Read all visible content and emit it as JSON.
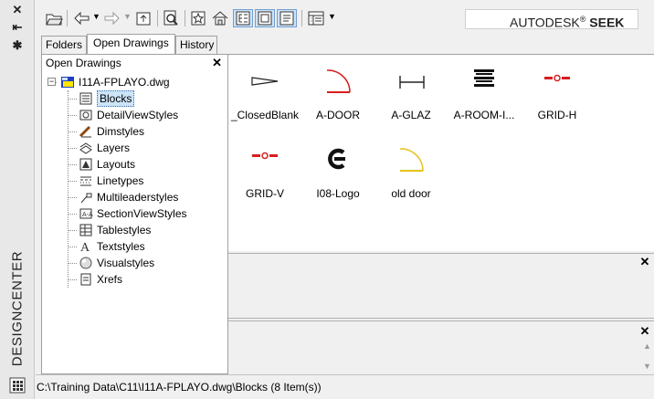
{
  "palette_title": "DESIGNCENTER",
  "brand": {
    "name": "AUTODESK",
    "reg": "®",
    "product": "SEEK"
  },
  "tabs": [
    "Folders",
    "Open Drawings",
    "History"
  ],
  "tree": {
    "header": "Open Drawings",
    "drawing": "I11A-FPLAYO.dwg",
    "items": [
      {
        "label": "Blocks",
        "icon": "blocks-icon",
        "selected": true
      },
      {
        "label": "DetailViewStyles",
        "icon": "detail-view-styles-icon"
      },
      {
        "label": "Dimstyles",
        "icon": "dimstyles-icon"
      },
      {
        "label": "Layers",
        "icon": "layers-icon"
      },
      {
        "label": "Layouts",
        "icon": "layouts-icon"
      },
      {
        "label": "Linetypes",
        "icon": "linetypes-icon"
      },
      {
        "label": "Multileaderstyles",
        "icon": "multileaderstyles-icon"
      },
      {
        "label": "SectionViewStyles",
        "icon": "section-view-styles-icon"
      },
      {
        "label": "Tablestyles",
        "icon": "tablestyles-icon"
      },
      {
        "label": "Textstyles",
        "icon": "textstyles-icon"
      },
      {
        "label": "Visualstyles",
        "icon": "visualstyles-icon"
      },
      {
        "label": "Xrefs",
        "icon": "xrefs-icon"
      }
    ]
  },
  "blocks": [
    {
      "name": "_ClosedBlank",
      "icon": "closed-blank-arrow-icon"
    },
    {
      "name": "A-DOOR",
      "icon": "door-swing-red-icon"
    },
    {
      "name": "A-GLAZ",
      "icon": "glazing-line-icon"
    },
    {
      "name": "A-ROOM-I...",
      "icon": "room-tag-icon"
    },
    {
      "name": "GRID-H",
      "icon": "grid-h-tag-icon"
    },
    {
      "name": "GRID-V",
      "icon": "grid-v-tag-icon"
    },
    {
      "name": "I08-Logo",
      "icon": "logo-c-icon"
    },
    {
      "name": "old door",
      "icon": "door-swing-yellow-icon"
    }
  ],
  "status_text": "C:\\Training Data\\C11\\I11A-FPLAYO.dwg\\Blocks (8 Item(s))",
  "colors": {
    "accent_red": "#d81e1e",
    "door_yellow": "#e6c21c",
    "selection": "#cce4f7"
  }
}
